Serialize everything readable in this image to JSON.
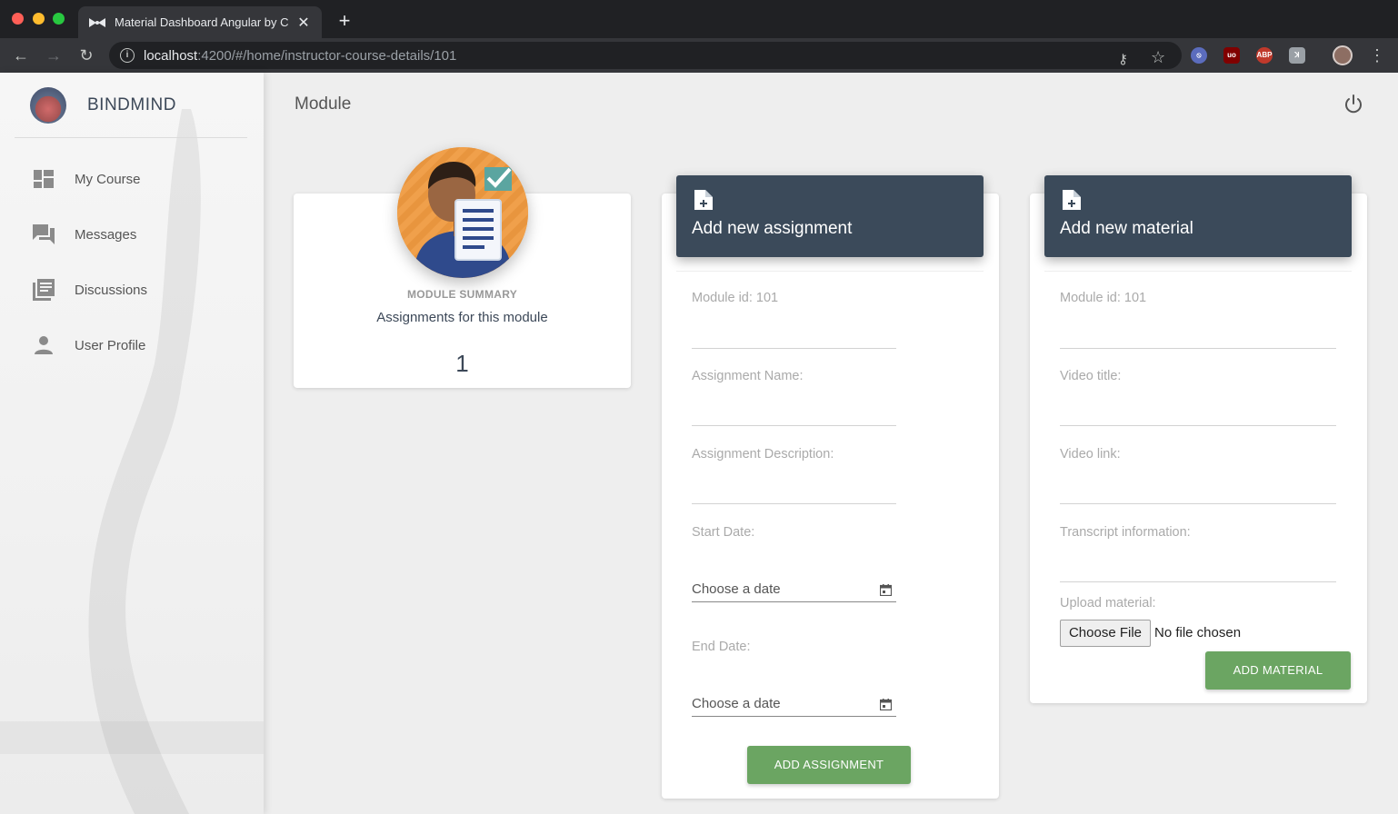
{
  "browser": {
    "tab_title": "Material Dashboard Angular by C",
    "url_host": "localhost",
    "url_rest": ":4200/#/home/instructor-course-details/101"
  },
  "sidebar": {
    "brand": "BINDMIND",
    "items": [
      {
        "label": "My Course",
        "icon": "dashboard-icon"
      },
      {
        "label": "Messages",
        "icon": "chat-icon"
      },
      {
        "label": "Discussions",
        "icon": "library-books-icon"
      },
      {
        "label": "User Profile",
        "icon": "person-icon"
      }
    ]
  },
  "header": {
    "title": "Module"
  },
  "summary": {
    "category": "MODULE SUMMARY",
    "description": "Assignments for this module",
    "count": "1"
  },
  "assignment_form": {
    "title": "Add new assignment",
    "module_id": "Module id: 101",
    "name_label": "Assignment Name:",
    "description_label": "Assignment Description:",
    "start_label": "Start Date:",
    "start_placeholder": "Choose a date",
    "end_label": "End Date:",
    "end_placeholder": "Choose a date",
    "submit": "ADD ASSIGNMENT"
  },
  "material_form": {
    "title": "Add new material",
    "module_id": "Module id: 101",
    "video_title_label": "Video title:",
    "video_link_label": "Video link:",
    "transcript_label": "Transcript information:",
    "upload_label": "Upload material:",
    "choose_file": "Choose File",
    "file_status": "No file chosen",
    "submit": "ADD MATERIAL"
  },
  "colors": {
    "header_bg": "#3b4a5a",
    "button_green": "#6ba562",
    "page_bg": "#eeeeee"
  }
}
